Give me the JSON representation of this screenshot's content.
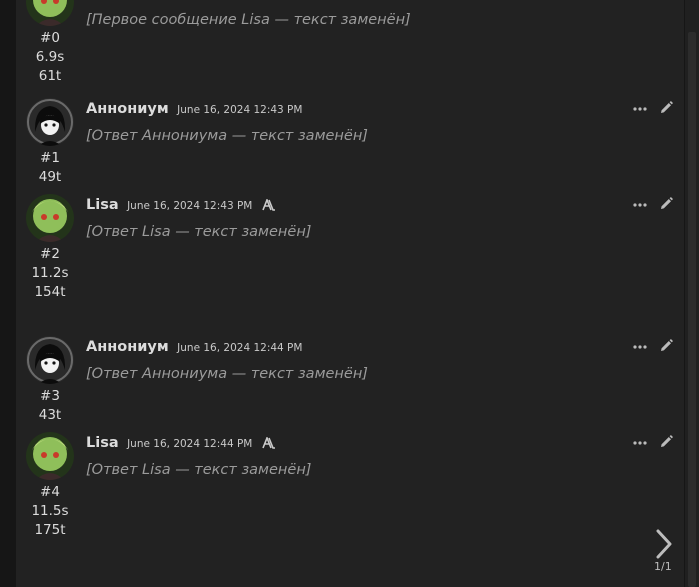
{
  "messages": [
    {
      "index": "#0",
      "time_stat": "6.9s",
      "tokens": "61t",
      "name": "",
      "date": "",
      "character": "lisa",
      "lines": [
        "[Первое сообщение Lisa — текст заменён]"
      ]
    },
    {
      "index": "#1",
      "time_stat": "",
      "tokens": "49t",
      "name": "Аннониум",
      "date": "June 16, 2024 12:43 PM",
      "character": "annonium",
      "lines": [
        "[Ответ Аннониума — текст заменён]"
      ]
    },
    {
      "index": "#2",
      "time_stat": "11.2s",
      "tokens": "154t",
      "name": "Lisa",
      "date": "June 16, 2024 12:43 PM",
      "character": "lisa",
      "lines": [
        "[Ответ Lisa — текст заменён]"
      ]
    },
    {
      "index": "#3",
      "time_stat": "",
      "tokens": "43t",
      "name": "Аннониум",
      "date": "June 16, 2024 12:44 PM",
      "character": "annonium",
      "lines": [
        "[Ответ Аннониума — текст заменён]"
      ]
    },
    {
      "index": "#4",
      "time_stat": "11.5s",
      "tokens": "175t",
      "name": "Lisa",
      "date": "June 16, 2024 12:44 PM",
      "character": "lisa",
      "lines": [
        "[Ответ Lisa — текст заменён]"
      ]
    }
  ],
  "pager": {
    "count": "1/1"
  },
  "icons": {
    "menu": "ellipsis-icon",
    "edit": "pencil-icon",
    "model": "model-glyph-icon",
    "next": "chevron-right-icon"
  },
  "colors": {
    "background": "#222222",
    "narration": "#9b9b9b",
    "speech": "#f08a24",
    "name": "#dcdcdc"
  }
}
